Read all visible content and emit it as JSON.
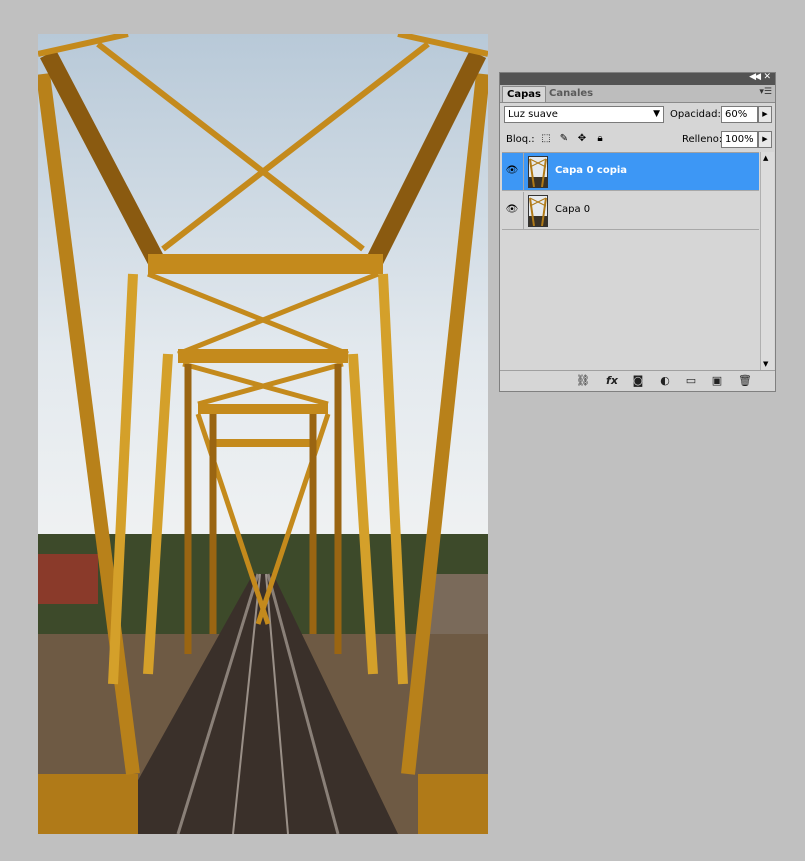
{
  "panel": {
    "tabs": [
      {
        "label": "Capas"
      },
      {
        "label": "Canales"
      }
    ],
    "blend_mode": "Luz suave",
    "opacity_label": "Opacidad:",
    "opacity_value": "60%",
    "lock_label": "Bloq.:",
    "fill_label": "Relleno:",
    "fill_value": "100%",
    "layers": [
      {
        "name": "Capa 0 copia",
        "visible": true,
        "selected": true
      },
      {
        "name": "Capa 0",
        "visible": true,
        "selected": false
      }
    ],
    "footer_icons": [
      "link-layers-icon",
      "fx-icon",
      "add-mask-icon",
      "adjustment-layer-icon",
      "new-group-icon",
      "new-layer-icon",
      "delete-layer-icon"
    ]
  },
  "colors": {
    "selection": "#3d97f5",
    "background": "#c0c0c0"
  }
}
